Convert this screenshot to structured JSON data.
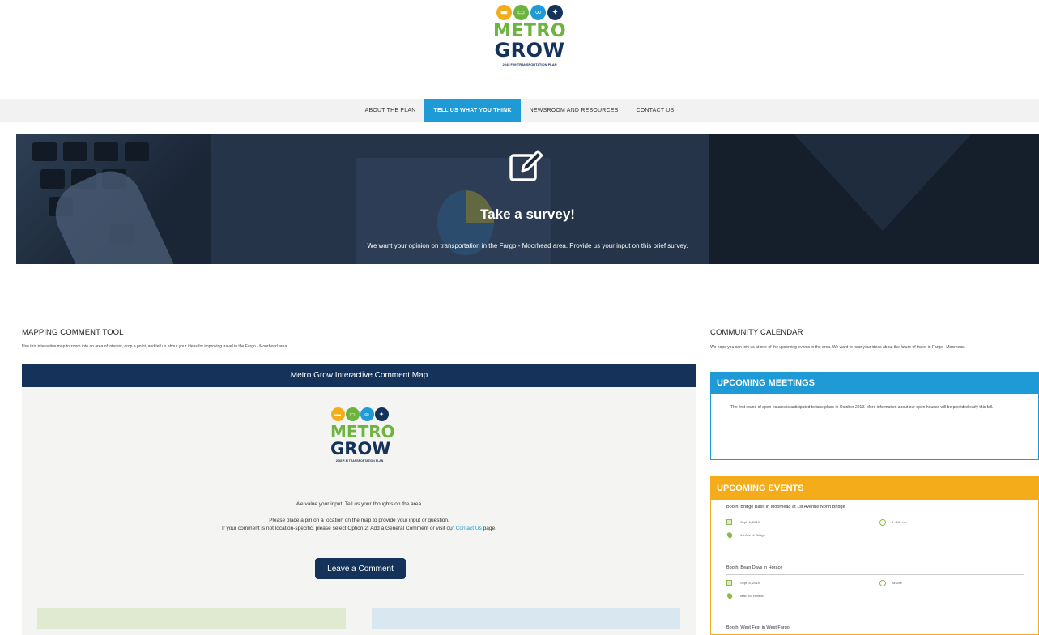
{
  "logo": {
    "word1": "METRO",
    "word2": "GROW",
    "tagline": "2045 F-M TRANSPORTATION PLAN",
    "dot_colors": [
      "#f5ac1b",
      "#6cb33f",
      "#1e9ad6",
      "#14325a"
    ],
    "icons": [
      "car-icon",
      "bus-icon",
      "bike-icon",
      "pedestrian-icon"
    ]
  },
  "nav": {
    "items": [
      "ABOUT THE PLAN",
      "TELL US WHAT YOU THINK",
      "NEWSROOM AND RESOURCES",
      "CONTACT US"
    ],
    "active_index": 1
  },
  "hero": {
    "icon": "edit-icon",
    "title": "Take a survey!",
    "subtitle": "We want your opinion on transportation in the Fargo - Moorhead area. Provide us your input on this brief survey."
  },
  "mapping": {
    "title": "MAPPING COMMENT TOOL",
    "description": "Use this interactive map to zoom into an area of interest, drop a point, and tell us about your ideas for improving travel in the Fargo - Moorhead area.",
    "map_header": "Metro Grow Interactive Comment Map",
    "line1": "We value your input! Tell us your thoughts on the area.",
    "line2": "Please place a pin on a location on the map to provide your input or question.",
    "line3_pre": "If your comment is not location-specific, please select Option 2: Add a General Comment or visit our",
    "line3_link": "Contact Us",
    "line3_post": "page.",
    "button": "Leave a Comment"
  },
  "calendar": {
    "title": "COMMUNITY CALENDAR",
    "description": "We hope you can join us at one of the upcoming events in the area. We want to hear your ideas about the future of travel in Fargo - Moorhead.",
    "meetings_title": "UPCOMING MEETINGS",
    "meetings_text": "The first round of open houses is anticipated to take place in October 2019. More information about our open houses will be provided early this fall.",
    "events_title": "UPCOMING EVENTS",
    "events": [
      {
        "name": "Booth: Bridge Bash in Moorhead at 1st Avenue North Bridge",
        "date": "Sept. 6, 2019",
        "time": "6 - 10 p.m.",
        "location": "1st Ave N. Bridge"
      },
      {
        "name": "Booth: Bean Days in Horace",
        "date": "Sept. 8, 2019",
        "time": "All Day",
        "location": "Main St. Horace"
      },
      {
        "name": "Booth: West Fest in West Fargo",
        "date": "",
        "time": "",
        "location": ""
      }
    ]
  }
}
